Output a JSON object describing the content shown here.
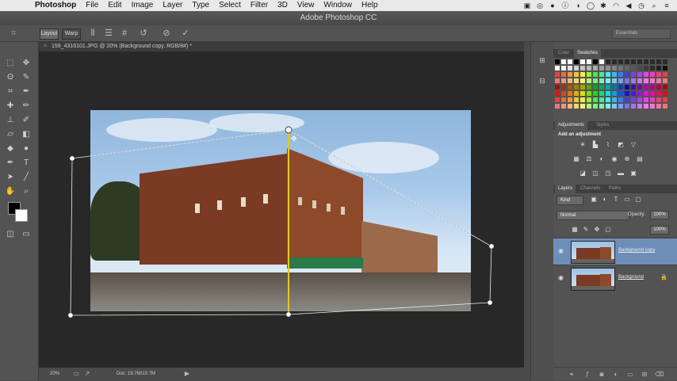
{
  "menubar": {
    "items": [
      "Photoshop",
      "File",
      "Edit",
      "Image",
      "Layer",
      "Type",
      "Select",
      "Filter",
      "3D",
      "View",
      "Window",
      "Help"
    ]
  },
  "window": {
    "title": "Adobe Photoshop CC"
  },
  "options_bar": {
    "layout_label": "Layout",
    "warp_label": "Warp",
    "workspace": "Essentials"
  },
  "document": {
    "tab_title": "159_4316101.JPG @ 20% (Background copy, RGB/8#) *",
    "tab_close": "×"
  },
  "status_bar": {
    "zoom": "20%",
    "doc_size": "Doc: 19.7M/19.7M"
  },
  "panels": {
    "color_tabs": [
      "Color",
      "Swatches"
    ],
    "adjust_tabs": [
      "Adjustments",
      "Styles"
    ],
    "adjust_heading": "Add an adjustment",
    "layer_tabs": [
      "Layers",
      "Channels",
      "Paths"
    ],
    "kind_label": "Kind",
    "blend_mode": "Normal",
    "opacity_label": "Opacity:",
    "opacity_value": "100%",
    "fill_value": "100%",
    "layers": [
      {
        "name": "Background copy",
        "selected": true
      },
      {
        "name": "Background",
        "selected": false
      }
    ]
  },
  "colors": {
    "accent_selection": "#6e8eb8",
    "guide_line": "#e8c620",
    "swatches": [
      "#000000",
      "#ffffff",
      "#ff0000",
      "#ffff00",
      "#00ff00",
      "#00ffff",
      "#0000ff",
      "#ff00ff"
    ]
  },
  "icons": {
    "tools": [
      "move",
      "marquee",
      "lasso",
      "quick-select",
      "crop",
      "eyedropper",
      "healing",
      "brush",
      "stamp",
      "history-brush",
      "eraser",
      "gradient",
      "blur",
      "dodge",
      "pen",
      "type",
      "path-select",
      "shape",
      "hand",
      "zoom"
    ]
  }
}
